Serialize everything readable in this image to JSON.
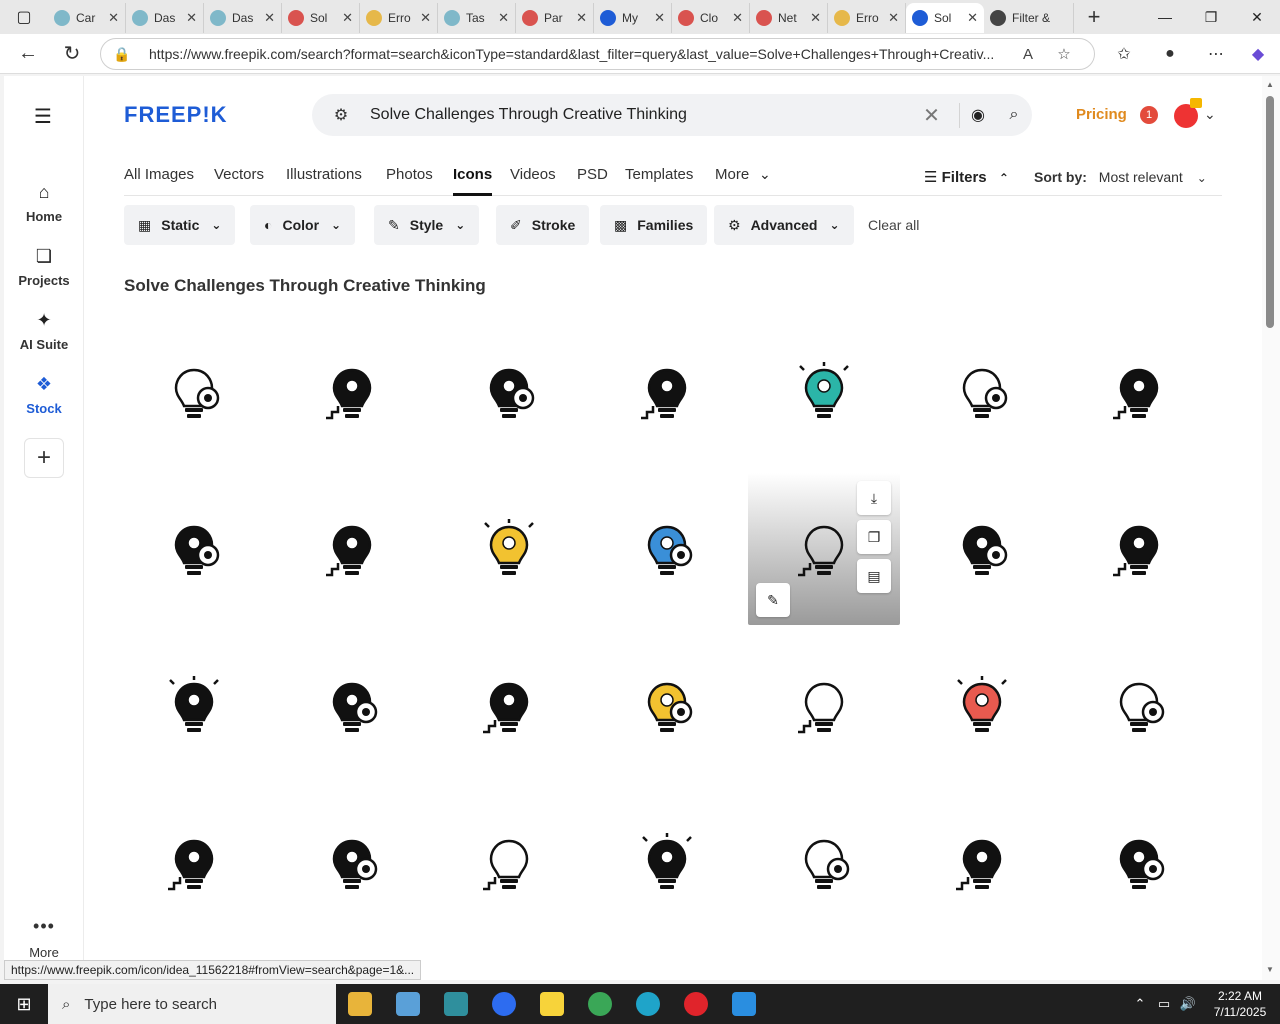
{
  "browser": {
    "tabs": [
      {
        "title": "Car",
        "color": "#7fb8c9"
      },
      {
        "title": "Das",
        "color": "#7fb8c9"
      },
      {
        "title": "Das",
        "color": "#7fb8c9"
      },
      {
        "title": "Sol",
        "color": "#d9534f"
      },
      {
        "title": "Erro",
        "color": "#e6b84a"
      },
      {
        "title": "Tas",
        "color": "#7fb8c9"
      },
      {
        "title": "Par",
        "color": "#d9534f"
      },
      {
        "title": "My",
        "color": "#1e5cd6"
      },
      {
        "title": "Clo",
        "color": "#d9534f"
      },
      {
        "title": "Net",
        "color": "#d9534f"
      },
      {
        "title": "Erro",
        "color": "#e6b84a"
      },
      {
        "title": "Sol",
        "color": "#1e5cd6"
      },
      {
        "title": "Filter &",
        "color": "#444444"
      }
    ],
    "active_tab_index": 11,
    "url": "https://www.freepik.com/search?format=search&iconType=standard&last_filter=query&last_value=Solve+Challenges+Through+Creativ..."
  },
  "site": {
    "logo": "FREEP!K",
    "search_value": "Solve Challenges Through Creative Thinking",
    "pricing": "Pricing",
    "notif_count": "1",
    "accent": "#1e5cd6",
    "pricing_color": "#e08a1e"
  },
  "leftnav": {
    "items": [
      {
        "label": "Home",
        "icon": "home-icon"
      },
      {
        "label": "Projects",
        "icon": "projects-icon"
      },
      {
        "label": "AI Suite",
        "icon": "sparkle-icon"
      },
      {
        "label": "Stock",
        "icon": "stock-icon"
      }
    ],
    "more": "More"
  },
  "type_tabs": [
    "All Images",
    "Vectors",
    "Illustrations",
    "Photos",
    "Icons",
    "Videos",
    "PSD",
    "Templates",
    "More"
  ],
  "active_type_tab": "Icons",
  "filters_label": "Filters",
  "sort": {
    "label": "Sort by:",
    "value": "Most relevant"
  },
  "filter_buttons": [
    {
      "label": "Static",
      "icon": "static-icon"
    },
    {
      "label": "Color",
      "icon": "palette-icon"
    },
    {
      "label": "Style",
      "icon": "brush-icon"
    },
    {
      "label": "Stroke",
      "icon": "pen-icon"
    },
    {
      "label": "Families",
      "icon": "grid-icon"
    },
    {
      "label": "Advanced",
      "icon": "gear-icon"
    }
  ],
  "clear_all": "Clear all",
  "results_title": "Solve Challenges Through Creative Thinking",
  "icons": [
    {
      "name": "lightbulb-head-gears-icon",
      "style": "outline"
    },
    {
      "name": "lightbulb-target-stairs-icon",
      "style": "solid"
    },
    {
      "name": "lightbulb-target-rings-icon",
      "style": "solid"
    },
    {
      "name": "lightbulb-pencil-icon",
      "style": "solid"
    },
    {
      "name": "lightbulb-target-stairs-color-icon",
      "style": "color"
    },
    {
      "name": "cloud-lightbulb-icon",
      "style": "outline"
    },
    {
      "name": "hand-lightbulb-icon",
      "style": "solid"
    },
    {
      "name": "head-lightbulb-idea-icon",
      "style": "solid"
    },
    {
      "name": "person-lightbulb-icon",
      "style": "solid"
    },
    {
      "name": "head-dollar-bulb-color-icon",
      "style": "color"
    },
    {
      "name": "lightbulb-key-color-icon",
      "style": "color"
    },
    {
      "name": "head-lightbulb-outline-icon",
      "style": "outline"
    },
    {
      "name": "lightbulb-arrow-target-icon",
      "style": "solid"
    },
    {
      "name": "lightbulb-puzzle-icon",
      "style": "solid"
    },
    {
      "name": "brain-lightbulb-puzzle-icon",
      "style": "solid"
    },
    {
      "name": "target-lightbulb-arrows-icon",
      "style": "solid"
    },
    {
      "name": "cloud-target-bulb-icon",
      "style": "solid"
    },
    {
      "name": "lightbulb-target-cloud-color-icon",
      "style": "color"
    },
    {
      "name": "bulb-target-circles-outline-icon",
      "style": "outline"
    },
    {
      "name": "lightbulb-target-stairs-teal-icon",
      "style": "color"
    },
    {
      "name": "lightbulb-target-stairs-outline-icon",
      "style": "outline"
    },
    {
      "name": "lightbulb-key-icon",
      "style": "solid"
    },
    {
      "name": "lightbulb-gear-icon",
      "style": "solid"
    },
    {
      "name": "lightbulb-target-arrow-icon",
      "style": "outline"
    },
    {
      "name": "rocket-lightbulb-icon",
      "style": "solid"
    },
    {
      "name": "bulb-target-arrow-outline-icon",
      "style": "outline"
    },
    {
      "name": "puzzle-lightbulb-icon",
      "style": "solid"
    },
    {
      "name": "lightbulb-dartboard-icon",
      "style": "solid"
    }
  ],
  "hovered_icon_index": 11,
  "status_link": "https://www.freepik.com/icon/idea_11562218#fromView=search&page=1&...",
  "taskbar": {
    "search_placeholder": "Type here to search",
    "time": "2:22 AM",
    "date": "7/11/2025"
  }
}
